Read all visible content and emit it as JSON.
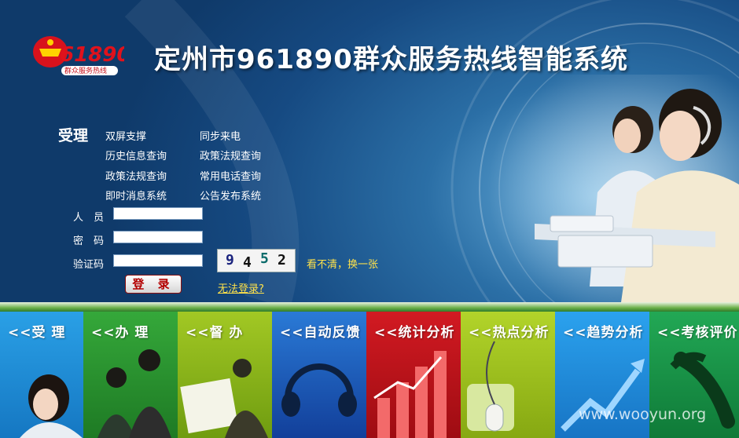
{
  "header": {
    "logo_number": "61890",
    "logo_caption": "群众服务热线",
    "title": "定州市961890群众服务热线智能系统"
  },
  "features": {
    "section_label": "受理",
    "items": [
      "双屏支撑",
      "同步来电",
      "历史信息查询",
      "政策法规查询",
      "政策法规查询",
      "常用电话查询",
      "即时消息系统",
      "公告发布系统"
    ]
  },
  "login": {
    "user_label": "人　员",
    "password_label": "密　码",
    "captcha_label": "验证码",
    "user_value": "",
    "password_value": "",
    "captcha_value": "",
    "captcha_digits": [
      "9",
      "4",
      "5",
      "2"
    ],
    "refresh_captcha_link": "看不清，换一张",
    "login_button": "登 录",
    "cannot_login_link": "无法登录?"
  },
  "modules": [
    {
      "label": "<<受  理",
      "color": "#1e8fd8"
    },
    {
      "label": "<<办  理",
      "color": "#2e9a2e"
    },
    {
      "label": "<<督  办",
      "color": "#8cbf1e"
    },
    {
      "label": "<<自动反馈",
      "color": "#1a63c4"
    },
    {
      "label": "<<统计分析",
      "color": "#c0161e"
    },
    {
      "label": "<<热点分析",
      "color": "#9fc41a"
    },
    {
      "label": "<<趋势分析",
      "color": "#1d8ee0"
    },
    {
      "label": "<<考核评价",
      "color": "#1a9a48"
    }
  ],
  "watermark": "www.wooyun.org"
}
